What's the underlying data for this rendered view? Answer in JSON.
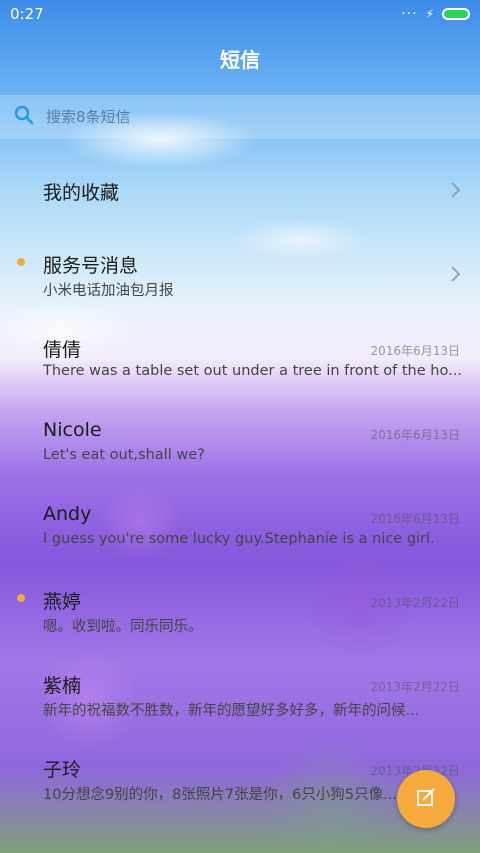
{
  "status_bar": {
    "time": "0:27",
    "signal_dots": "···"
  },
  "header": {
    "title": "短信"
  },
  "search": {
    "placeholder": "搜索8条短信"
  },
  "favorites": {
    "label": "我的收藏"
  },
  "service": {
    "name": "服务号消息",
    "preview": "小米电话加油包月报"
  },
  "conversations": [
    {
      "name": "倩倩",
      "date": "2016年6月13日",
      "preview": "There was a table set out under a tree in front of the ho...",
      "unread": false
    },
    {
      "name": "Nicole",
      "date": "2016年6月13日",
      "preview": "Let's eat out,shall we?",
      "unread": false
    },
    {
      "name": "Andy",
      "date": "2016年6月13日",
      "preview": "I guess you're some lucky guy.Stephanie is a nice girl.",
      "unread": false
    },
    {
      "name": "燕婷",
      "date": "2013年2月22日",
      "preview": "嗯。收到啦。同乐同乐。",
      "unread": true
    },
    {
      "name": "紫楠",
      "date": "2013年2月22日",
      "preview": "新年的祝福数不胜数，新年的愿望好多好多，新年的问候...",
      "unread": false
    },
    {
      "name": "子玲",
      "date": "2013年2月22日",
      "preview": "10分想念9别的你，8张照片7张是你，6只小狗5只像...",
      "unread": false
    }
  ],
  "colors": {
    "accent": "#f6aa3b",
    "unread_dot": "#f4a93a",
    "search_icon": "#1e9be8"
  },
  "icons": {
    "search": "search-icon",
    "compose": "compose-icon",
    "chevron": "chevron-right-icon"
  }
}
